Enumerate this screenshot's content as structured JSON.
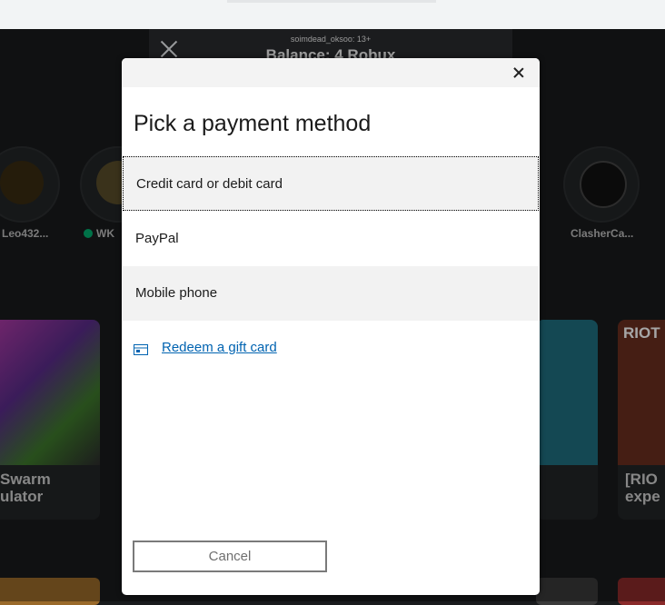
{
  "background": {
    "account_label": "soimdead_oksoo: 13+",
    "balance_label": "Balance: 4 Robux",
    "friends": [
      {
        "name": "Leo432..."
      },
      {
        "name": "WK"
      },
      {
        "name": "ClasherCa..."
      }
    ],
    "games": [
      {
        "title_line1": "Swarm",
        "title_line2": "ulator"
      },
      {
        "title_line1": "[RIO",
        "title_line2": "expe"
      }
    ],
    "riot_badge": "RIOT"
  },
  "dialog": {
    "heading": "Pick a payment method",
    "options": [
      {
        "label": "Credit card or debit card",
        "state": "focused"
      },
      {
        "label": "PayPal"
      },
      {
        "label": "Mobile phone"
      }
    ],
    "gift_link": "Redeem a gift card",
    "cancel_label": "Cancel"
  },
  "colors": {
    "link": "#0063b1",
    "option_bg": "#f2f2f2",
    "online": "#00b06f"
  }
}
